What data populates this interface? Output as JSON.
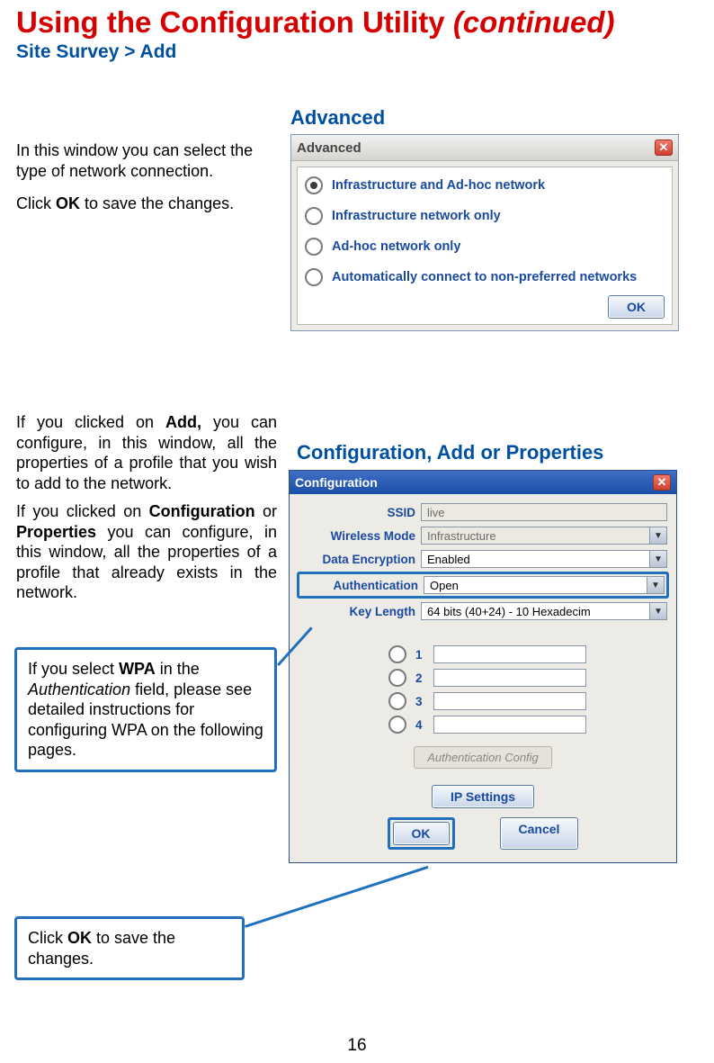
{
  "title": {
    "main": "Using the Configuration Utility ",
    "continued": "(continued)"
  },
  "breadcrumb": "Site Survey > Add",
  "sections": {
    "advanced_heading": "Advanced",
    "config_heading": "Configuration, Add or Properties"
  },
  "left_text": {
    "p1a": "In this window you can select the type of network connection.",
    "p1b_a": "Click ",
    "p1b_b": "OK",
    "p1b_c": " to save the changes.",
    "p2a_a": "If you clicked on ",
    "p2a_b": "Add,",
    "p2a_c": " you can configure, in this window, all the properties of a profile that you wish to add to the network.",
    "p2b_a": "If you clicked on ",
    "p2b_b": "Configuration",
    "p2b_c": " or ",
    "p2b_d": "Properties",
    "p2b_e": " you can configure, in this window, all the properties of a profile that already exists in the network."
  },
  "callouts": {
    "wpa_a": "If you select ",
    "wpa_b": "WPA",
    "wpa_c": " in the ",
    "wpa_d": "Authentication",
    "wpa_e": " field, please see detailed instructions for configuring WPA on the following pages.",
    "ok_a": "Click ",
    "ok_b": "OK",
    "ok_c": " to save the changes."
  },
  "advanced_dialog": {
    "title": "Advanced",
    "options": [
      "Infrastructure and Ad-hoc network",
      "Infrastructure  network only",
      "Ad-hoc network only",
      "Automatically connect to non-preferred networks"
    ],
    "ok": "OK"
  },
  "config_dialog": {
    "title": "Configuration",
    "labels": {
      "ssid": "SSID",
      "mode": "Wireless Mode",
      "enc": "Data Encryption",
      "auth": "Authentication",
      "keylen": "Key Length"
    },
    "values": {
      "ssid": "live",
      "mode": "Infrastructure",
      "enc": "Enabled",
      "auth": "Open",
      "keylen": "64 bits (40+24) - 10 Hexadecim"
    },
    "keys": [
      "1",
      "2",
      "3",
      "4"
    ],
    "authcfg": "Authentication Config",
    "ipsettings": "IP Settings",
    "ok": "OK",
    "cancel": "Cancel"
  },
  "page_number": "16"
}
